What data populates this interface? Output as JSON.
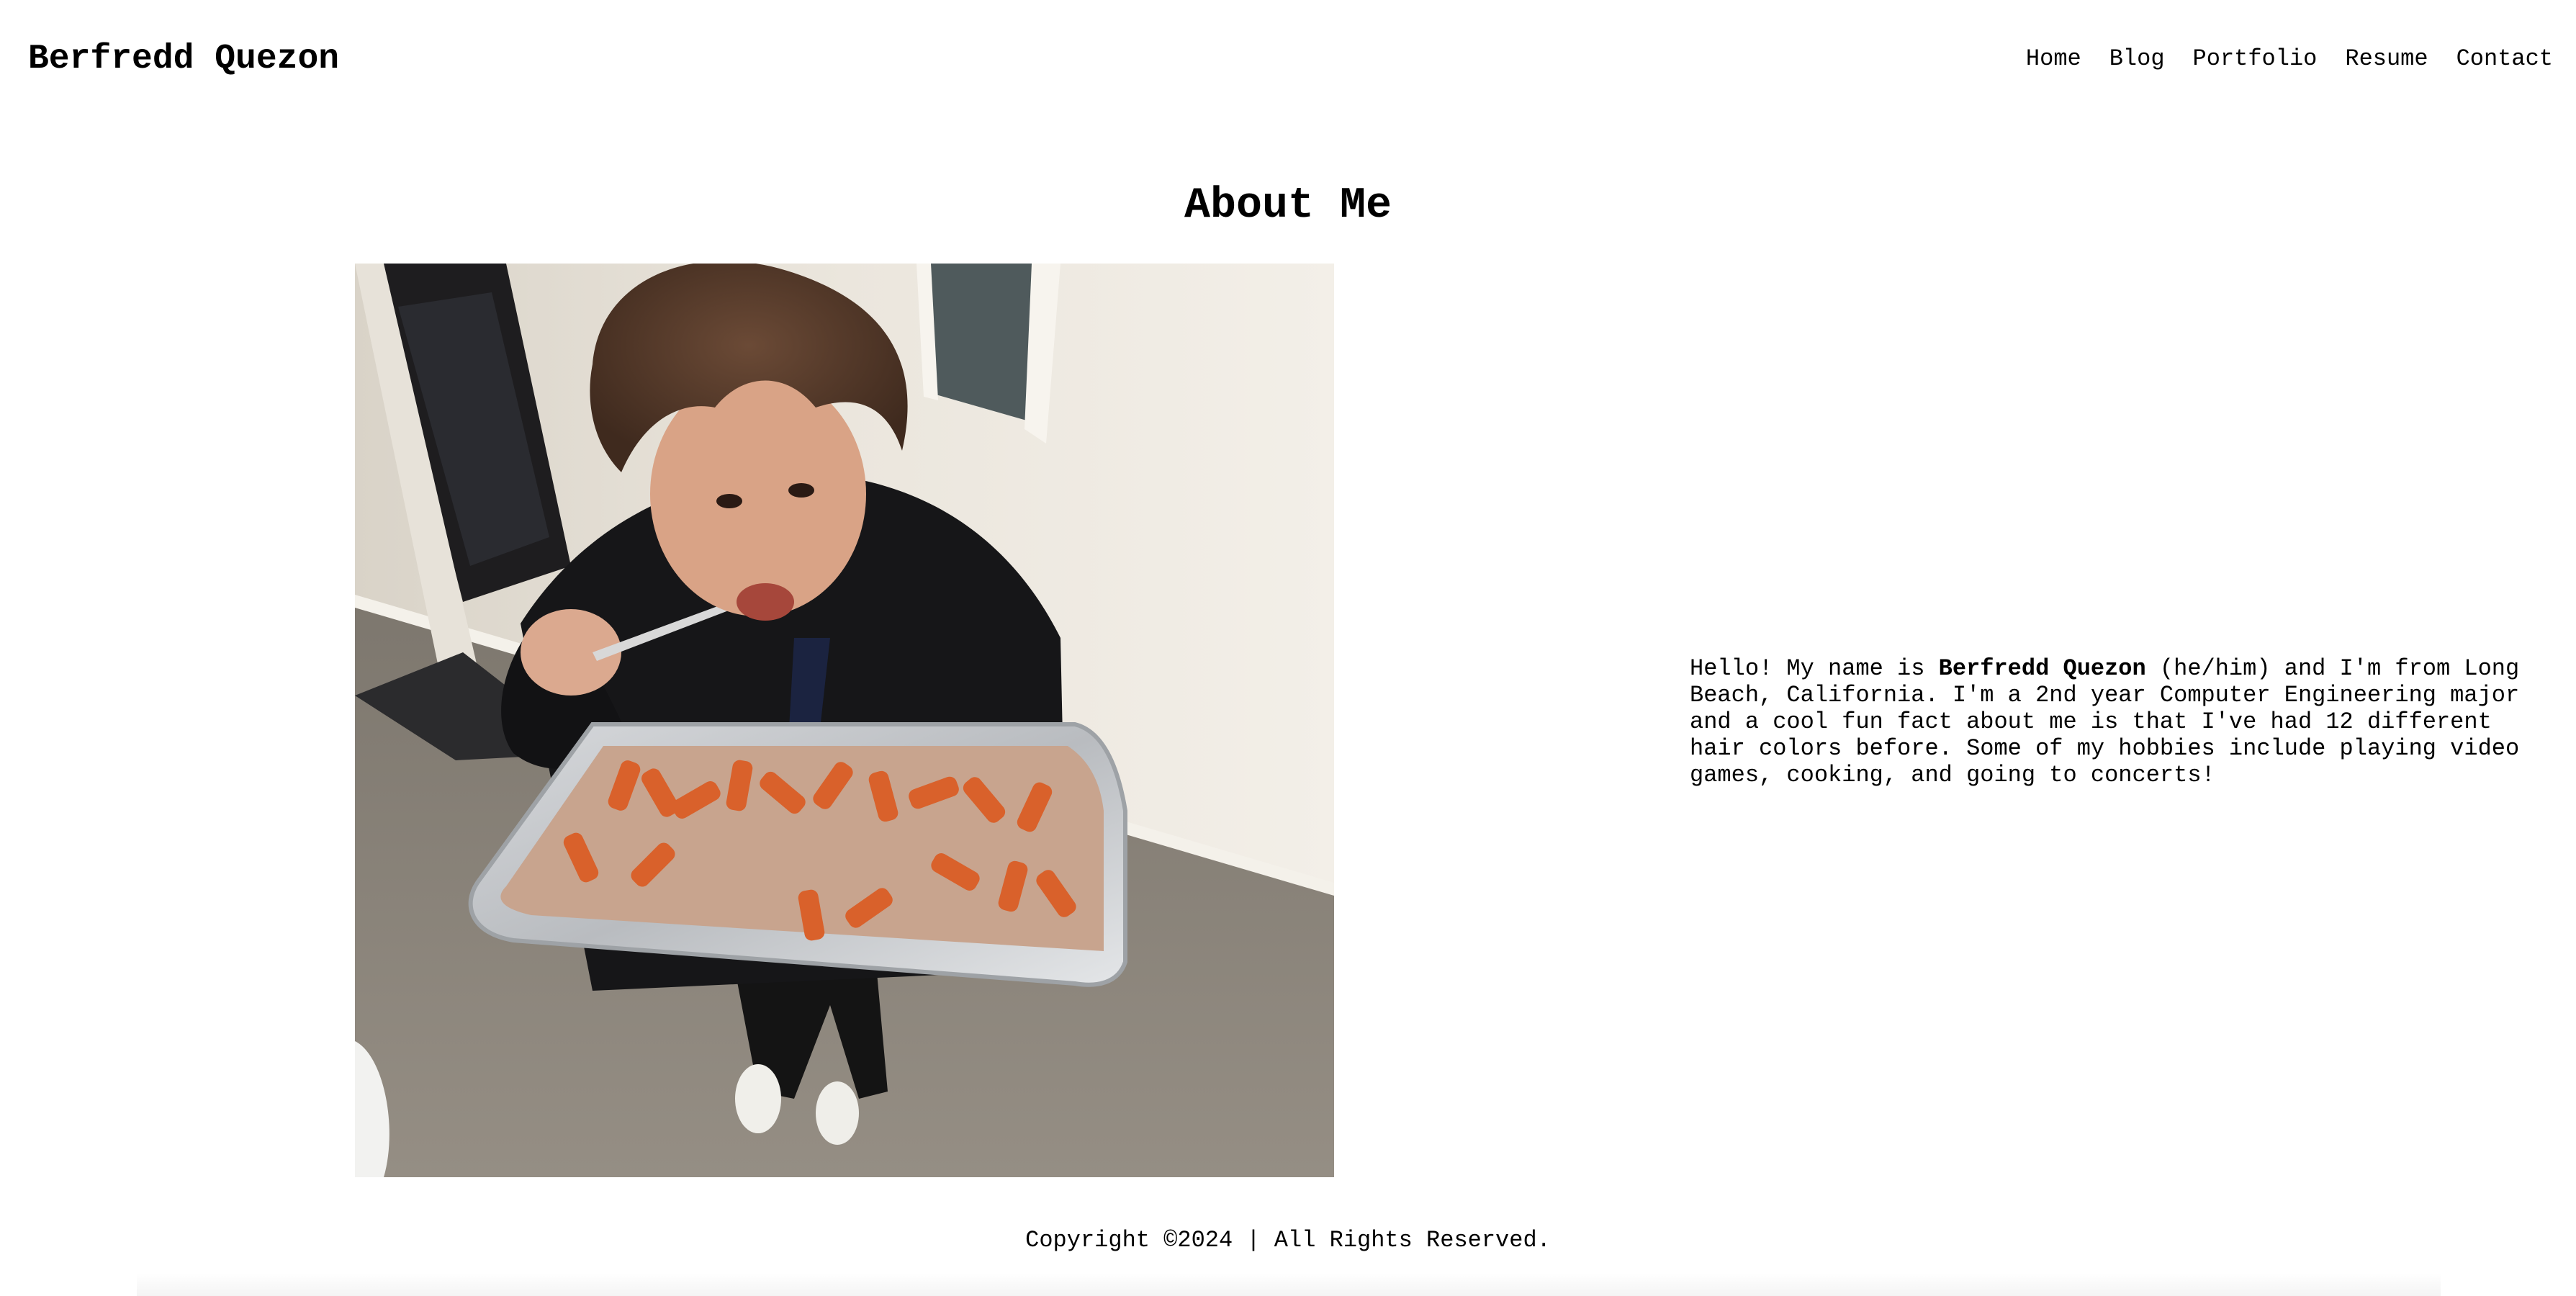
{
  "header": {
    "site_title": "Berfredd Quezon",
    "nav": [
      {
        "label": "Home"
      },
      {
        "label": "Blog"
      },
      {
        "label": "Portfolio"
      },
      {
        "label": "Resume"
      },
      {
        "label": "Contact"
      }
    ]
  },
  "main": {
    "heading": "About Me",
    "photo_icon": "person-eating-pasta-photo",
    "bio": {
      "before_name": "Hello! My name is ",
      "name": "Berfredd Quezon",
      "after_name": " (he/him) and I'm from Long Beach, California. I'm a 2nd year Computer Engineering major and a cool fun fact about me is that I've had 12 different hair colors before. Some of my hobbies include playing video games, cooking, and going to concerts!"
    }
  },
  "footer": {
    "copyright": "Copyright ©2024 | All Rights Reserved."
  },
  "colors": {
    "background": "#ffffff",
    "text": "#000000"
  }
}
